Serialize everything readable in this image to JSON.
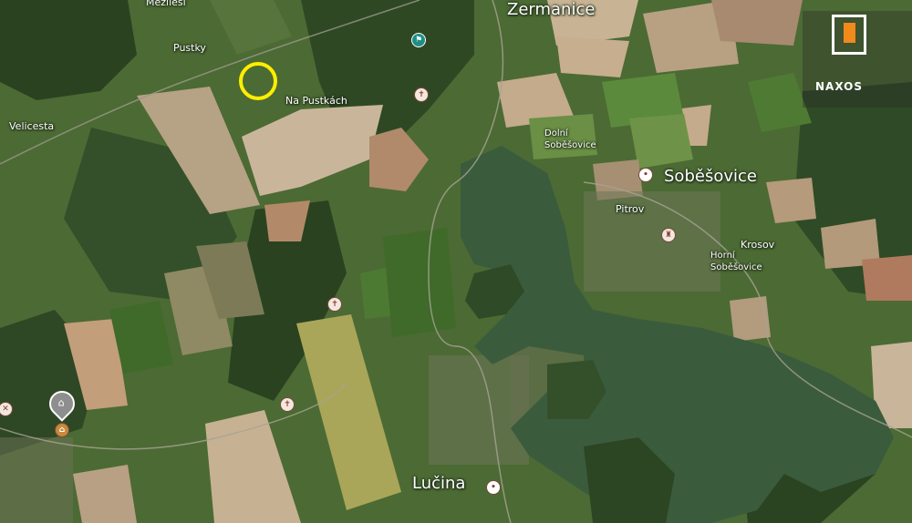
{
  "places": {
    "zermanice": "Zermanice",
    "sobesovice": "Soběšovice",
    "lucina": "Lučina",
    "mezilesi": "Mezilesí",
    "pustky": "Pustky",
    "na_pustkach": "Na Pustkách",
    "velicesta": "Velicesta",
    "dolni_sob_1": "Dolní",
    "dolni_sob_2": "Soběšovice",
    "pitrov": "Pitrov",
    "krosov": "Krosov",
    "horni_sob_1": "Horní",
    "horni_sob_2": "Soběšovice"
  },
  "brand": {
    "name": "NAXOS",
    "accent": "#f08a1a"
  },
  "marker": {
    "color": "#ffee00"
  },
  "colors": {
    "water": "#3a5a3a",
    "forest": "#2d4420",
    "field": "#b49c7c"
  },
  "icons": [
    "church-icon",
    "museum-pin-icon",
    "place-dot-icon",
    "castle-icon"
  ]
}
